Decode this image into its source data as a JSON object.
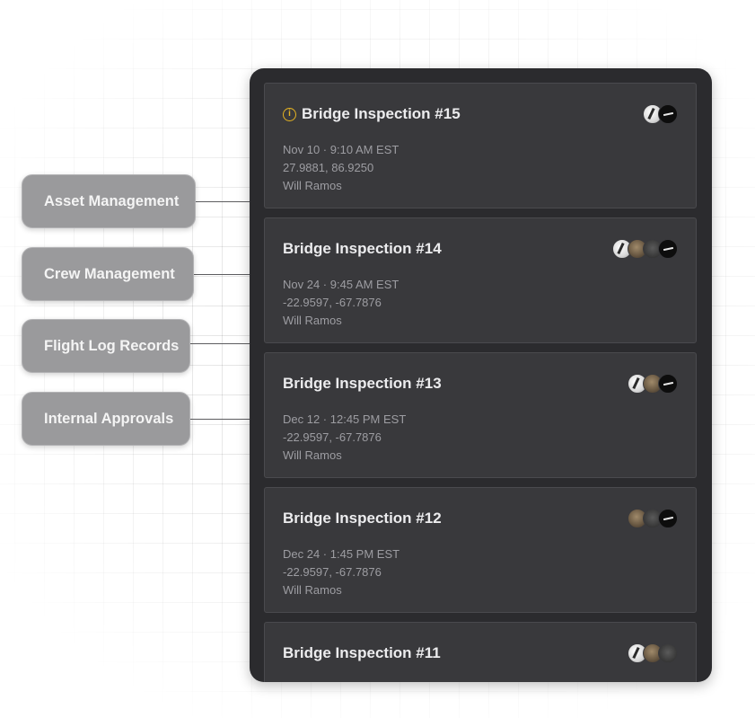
{
  "categories": [
    {
      "label": "Asset Management"
    },
    {
      "label": "Crew Management"
    },
    {
      "label": "Flight Log Records"
    },
    {
      "label": "Internal Approvals"
    }
  ],
  "inspections": [
    {
      "title": "Bridge Inspection #15",
      "has_alert": true,
      "datetime": "Nov 10 · 9:10 AM EST",
      "coords": "27.9881, 86.9250",
      "pilot": "Will Ramos",
      "avatars": [
        "white",
        "black"
      ]
    },
    {
      "title": "Bridge Inspection #14",
      "has_alert": false,
      "datetime": "Nov 24 · 9:45 AM EST",
      "coords": "-22.9597, -67.7876",
      "pilot": "Will Ramos",
      "avatars": [
        "white",
        "brown",
        "grey",
        "black"
      ]
    },
    {
      "title": "Bridge Inspection #13",
      "has_alert": false,
      "datetime": "Dec 12 · 12:45 PM EST",
      "coords": "-22.9597, -67.7876",
      "pilot": "Will Ramos",
      "avatars": [
        "white",
        "brown",
        "black"
      ]
    },
    {
      "title": "Bridge Inspection #12",
      "has_alert": false,
      "datetime": "Dec 24 · 1:45 PM EST",
      "coords": "-22.9597, -67.7876",
      "pilot": "Will Ramos",
      "avatars": [
        "brown",
        "grey",
        "black"
      ]
    },
    {
      "title": "Bridge Inspection #11",
      "has_alert": false,
      "datetime": "",
      "coords": "",
      "pilot": "",
      "avatars": [
        "white",
        "brown",
        "grey"
      ]
    }
  ],
  "icons": {
    "alert": "info-icon",
    "alert_glyph": "i"
  },
  "colors": {
    "panel": "#2b2b2e",
    "card": "#39393c",
    "alert": "#e6b422",
    "pill": "#9a9a9c"
  }
}
